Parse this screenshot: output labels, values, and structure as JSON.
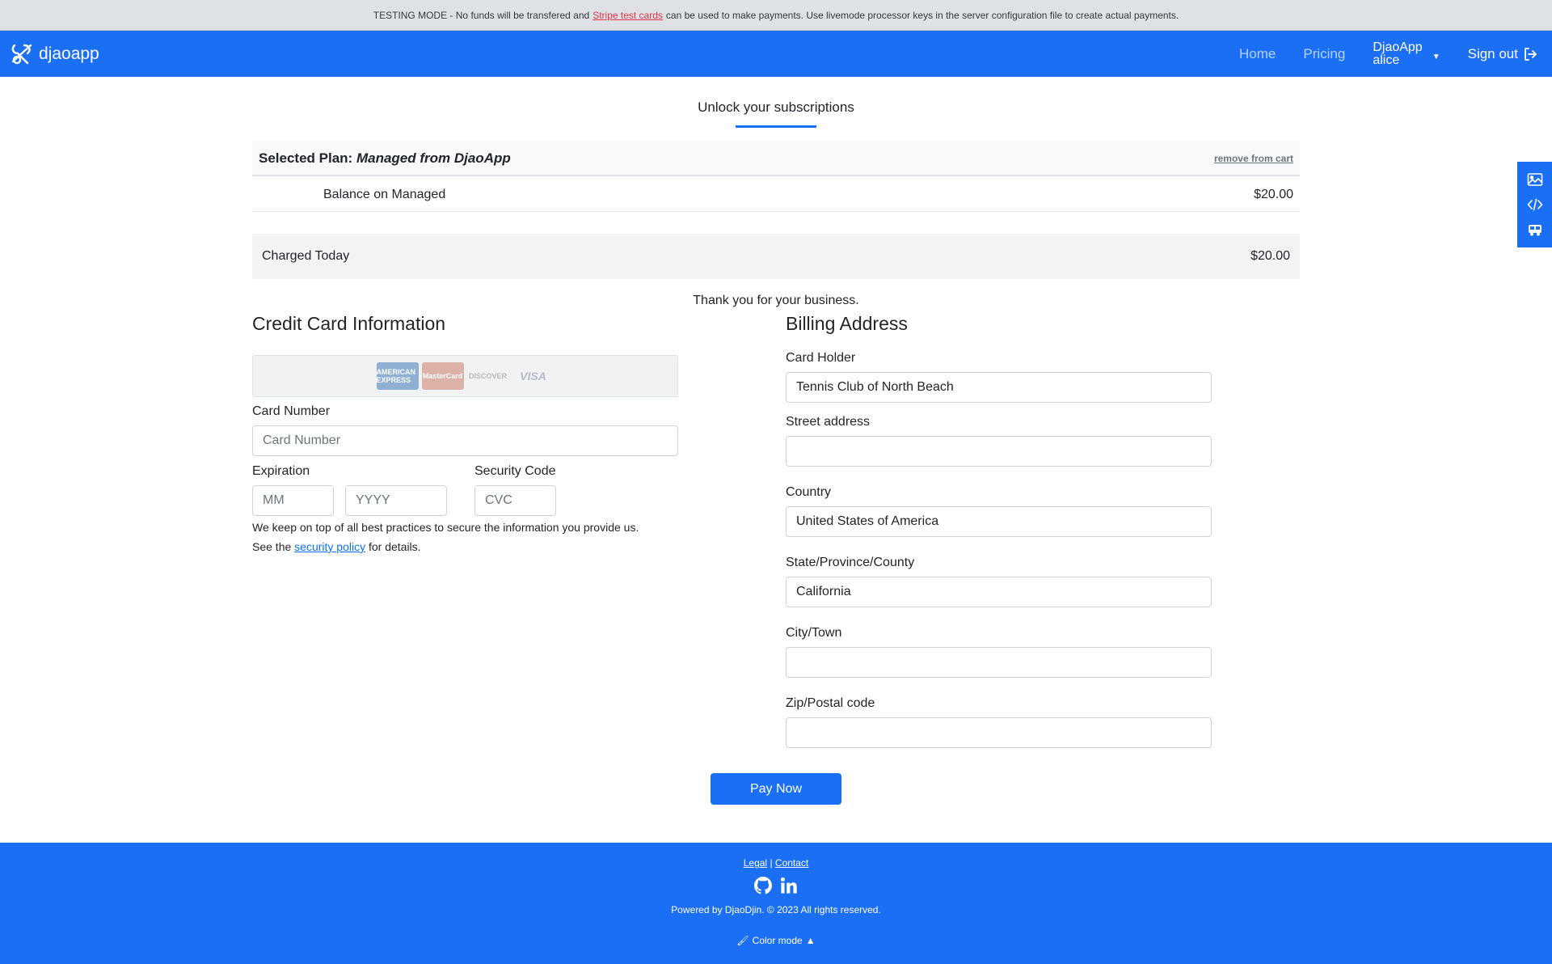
{
  "banner": {
    "prefix": "TESTING MODE - No funds will be transfered and",
    "link": "Stripe test cards",
    "suffix": "can be used to make payments. Use livemode processor keys in the server configuration file to create actual payments."
  },
  "navbar": {
    "brand": "djaoapp",
    "home": "Home",
    "pricing": "Pricing",
    "user_org": "DjaoApp",
    "user_name": "alice",
    "sign_out": "Sign out"
  },
  "side_tools": [
    "image-icon",
    "code-icon",
    "bus-icon"
  ],
  "main": {
    "title": "Unlock your subscriptions",
    "plan_prefix": "Selected Plan:",
    "plan_name": "Managed from DjaoApp",
    "remove": "remove from cart",
    "balance_label": "Balance on Managed",
    "balance_amount": "$20.00",
    "charged_label": "Charged Today",
    "charged_amount": "$20.00",
    "thanks": "Thank you for your business."
  },
  "credit_card": {
    "heading": "Credit Card Information",
    "logos": [
      "AMERICAN EXPRESS",
      "MasterCard",
      "DISCOVER",
      "VISA"
    ],
    "card_number_label": "Card Number",
    "card_number_placeholder": "Card Number",
    "expiration_label": "Expiration",
    "mm_placeholder": "MM",
    "yyyy_placeholder": "YYYY",
    "security_label": "Security Code",
    "cvc_placeholder": "CVC",
    "note_line1": "We keep on top of all best practices to secure the information you provide us.",
    "note_prefix": "See the",
    "note_link": "security policy",
    "note_suffix": "for details."
  },
  "billing": {
    "heading": "Billing Address",
    "card_holder_label": "Card Holder",
    "card_holder_value": "Tennis Club of North Beach",
    "street_label": "Street address",
    "street_value": "",
    "country_label": "Country",
    "country_value": "United States of America",
    "state_label": "State/Province/County",
    "state_value": "California",
    "city_label": "City/Town",
    "city_value": "",
    "zip_label": "Zip/Postal code",
    "zip_value": ""
  },
  "pay_button": "Pay Now",
  "footer": {
    "legal": "Legal",
    "separator": "|",
    "contact": "Contact",
    "powered": "Powered by DjaoDjin. © 2023 All rights reserved.",
    "color_mode": "Color mode"
  }
}
